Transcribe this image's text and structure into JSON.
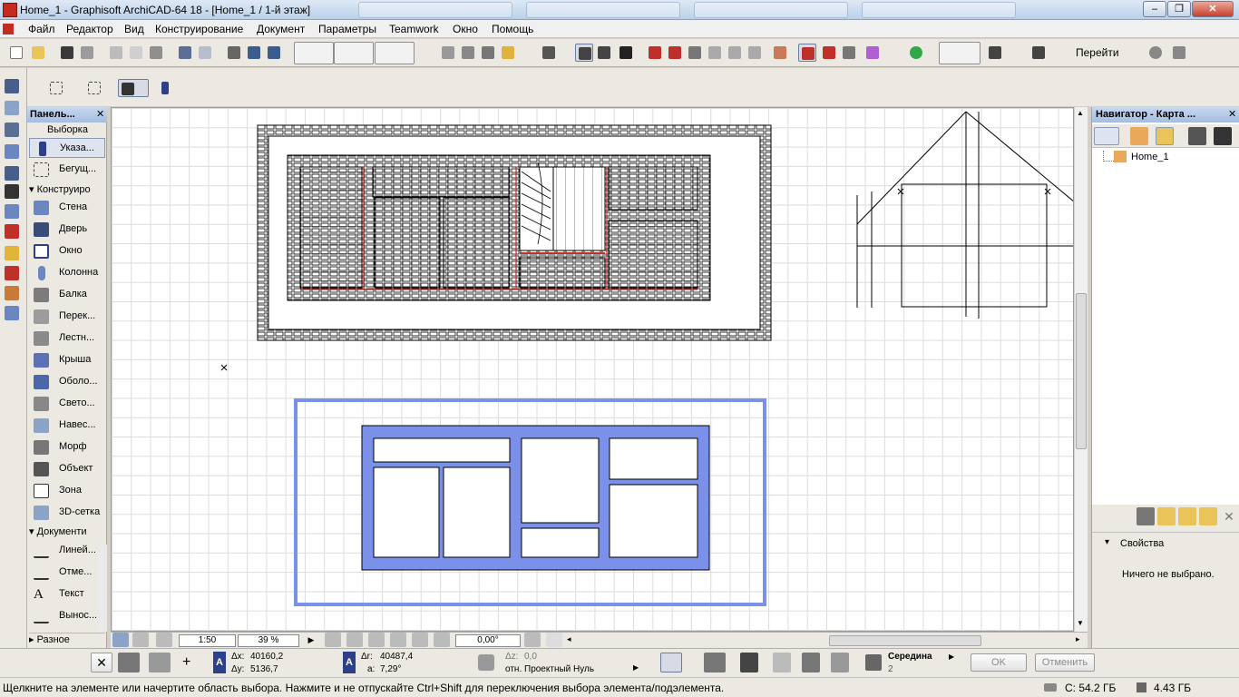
{
  "window": {
    "title": "Home_1 - Graphisoft ArchiCAD-64 18 - [Home_1 / 1-й этаж]",
    "min": "–",
    "max": "❐",
    "close": "✕"
  },
  "menu": [
    "Файл",
    "Редактор",
    "Вид",
    "Конструирование",
    "Документ",
    "Параметры",
    "Teamwork",
    "Окно",
    "Помощь"
  ],
  "toolbar": {
    "goto_label": "Перейти"
  },
  "toolbox": {
    "title": "Панель...",
    "selection_header": "Выборка",
    "selection_tools": [
      "Указа...",
      "Бегущ..."
    ],
    "section_construct": "Конструиро",
    "construct_tools": [
      "Стена",
      "Дверь",
      "Окно",
      "Колонна",
      "Балка",
      "Перек...",
      "Лестн...",
      "Крыша",
      "Оболо...",
      "Свето...",
      "Навес...",
      "Морф",
      "Объект",
      "Зона",
      "3D-сетка"
    ],
    "section_document": "Документи",
    "document_tools": [
      "Линей...",
      "Отме...",
      "Текст",
      "Вынос..."
    ],
    "section_misc": "Разное"
  },
  "viewbar": {
    "scale": "1:50",
    "zoom": "39 %",
    "angle": "0,00°"
  },
  "navigator": {
    "title": "Навигатор - Карта ...",
    "tree_item": "Home_1",
    "properties_label": "Свойства",
    "nothing_selected": "Ничего не выбрано."
  },
  "infobox": {
    "dx_label": "Δx:",
    "dx": "40160,2",
    "dy_label": "Δy:",
    "dy": "5136,7",
    "dr_label": "Δr:",
    "dr": "40487,4",
    "a_label": "a:",
    "a": "7,29°",
    "dz_label": "Δz:",
    "dz": "0,0",
    "ref": "отн. Проектный Нуль",
    "snap_label": "Середина",
    "snap_value": "2",
    "ok": "OK",
    "cancel": "Отменить"
  },
  "status": {
    "message": "Щелкните на элементе или начертите область выбора. Нажмите и не отпускайте Ctrl+Shift для переключения выбора элемента/подэлемента.",
    "disk_c": "C: 54.2 ГБ",
    "memory": "4.43 ГБ"
  },
  "colors": {
    "selection_blue": "#7b90e8",
    "hatch_red": "#c0302a",
    "title_blue": "#b9d1ea"
  }
}
